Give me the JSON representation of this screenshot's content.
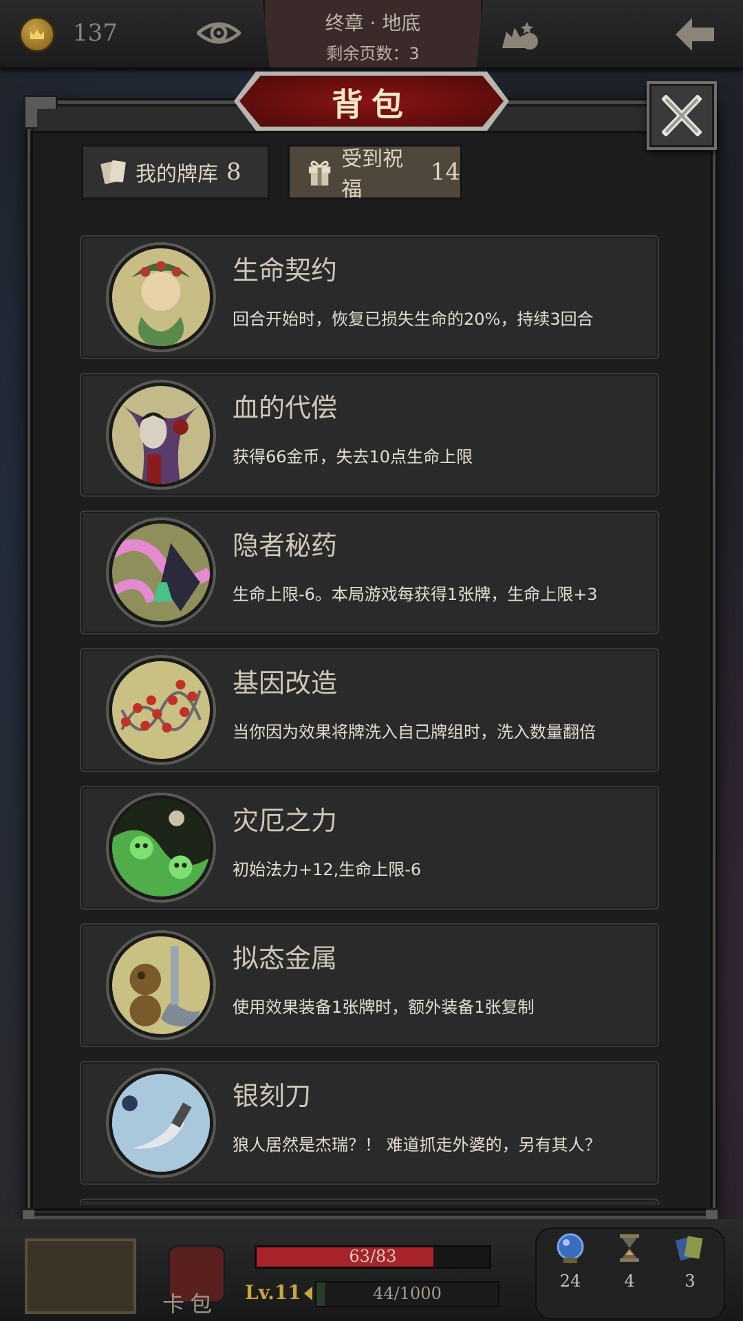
{
  "topbar": {
    "gold": "137",
    "chapter_title": "终章 · 地底",
    "pages_remaining": "剩余页数：3"
  },
  "panel": {
    "title": "背包",
    "tabs": [
      {
        "label": "我的牌库",
        "count": "8",
        "icon": "cards-icon",
        "active": false
      },
      {
        "label": "受到祝福",
        "count": "14",
        "icon": "gift-icon",
        "active": true
      }
    ]
  },
  "blessings": [
    {
      "name": "生命契约",
      "desc": "回合开始时，恢复已损失生命的20%，持续3回合",
      "icon": "vine-witch-portrait",
      "tone": "#c9bd86"
    },
    {
      "name": "血的代偿",
      "desc": "获得66金币，失去10点生命上限",
      "icon": "vampire-portrait",
      "tone": "#c2ba88"
    },
    {
      "name": "隐者秘药",
      "desc": "生命上限-6。本局游戏每获得1张牌，生命上限+3",
      "icon": "potion-portrait",
      "tone": "#8f8f5c"
    },
    {
      "name": "基因改造",
      "desc": "当你因为效果将牌洗入自己牌组时，洗入数量翻倍",
      "icon": "dna-portrait",
      "tone": "#c9c184"
    },
    {
      "name": "灾厄之力",
      "desc": "初始法力+12,生命上限-6",
      "icon": "green-skulls-portrait",
      "tone": "#2e3a22"
    },
    {
      "name": "拟态金属",
      "desc": "使用效果装备1张牌时，额外装备1张复制",
      "icon": "mimic-metal-portrait",
      "tone": "#c9c084"
    },
    {
      "name": "银刻刀",
      "desc": "狼人居然是杰瑞？！ 难道抓走外婆的，另有其人？",
      "icon": "silver-knife-portrait",
      "tone": "#b8d4e4"
    }
  ],
  "bottombar": {
    "cardbag_label": "卡包",
    "hp_text": "63/83",
    "hp_fraction": 0.759,
    "level": "Lv.11",
    "xp_text": "44/1000",
    "xp_fraction": 0.044,
    "stats": [
      {
        "icon": "crystal-ball-icon",
        "value": "24"
      },
      {
        "icon": "hourglass-icon",
        "value": "4"
      },
      {
        "icon": "card-stack-icon",
        "value": "3"
      }
    ]
  }
}
